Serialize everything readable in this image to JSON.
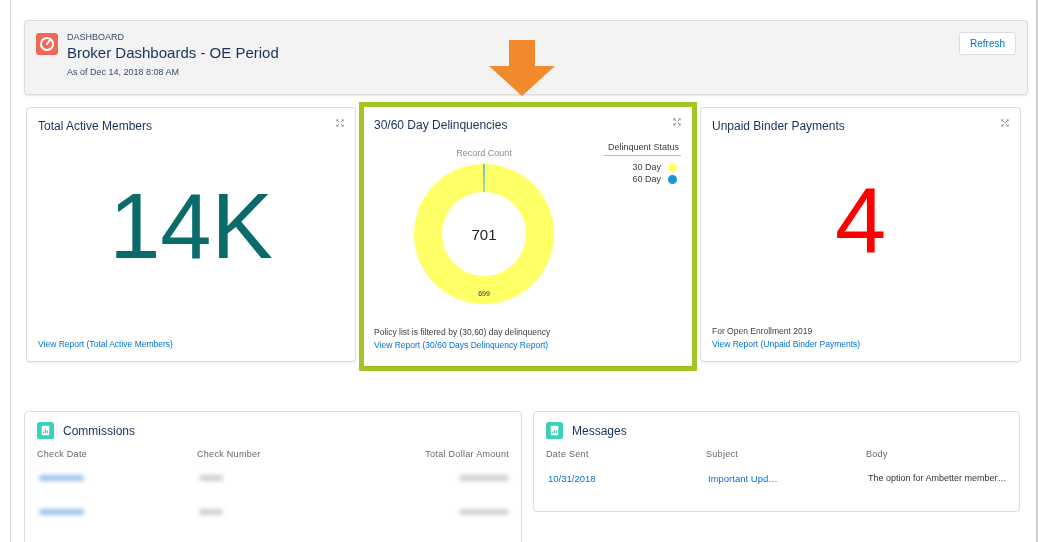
{
  "header": {
    "eyebrow": "DASHBOARD",
    "title": "Broker Dashboards - OE Period",
    "timestamp": "As of Dec 14, 2018 8:08 AM",
    "refresh_button": "Refresh"
  },
  "cards": [
    {
      "kind": "metric",
      "title": "Total Active Members",
      "highlighted": false,
      "value": "14K",
      "link": "View Report (Total Active Members)"
    },
    {
      "kind": "chart",
      "title": "30/60 Day Delinquencies",
      "highlighted": true,
      "center_label": "701",
      "note": "Policy list is filtered by (30,60) day delinquency",
      "link": "View Report (30/60 Days Delinquency Report)",
      "legend": {
        "title": "Delinquent Status",
        "items": [
          {
            "color": "#ffff66"
          },
          {
            "color": "#1b96d8"
          }
        ]
      },
      "chart_data": {
        "type": "donut",
        "title": "Record Count",
        "categories": [
          "30 Day",
          "60 Day"
        ],
        "values": [
          699,
          2
        ],
        "value_labels": [
          "699",
          null
        ]
      }
    },
    {
      "kind": "metric",
      "title": "Unpaid Binder Payments",
      "highlighted": false,
      "value": "4",
      "note": "For Open Enrollment 2019",
      "link": "View Report (Unpaid Binder Payments)"
    }
  ],
  "tables": [
    {
      "title": "Commissions",
      "columns": [
        {
          "label": "Check Date"
        },
        {
          "label": "Check Number"
        },
        {
          "label": "Total Dollar Amount"
        }
      ],
      "rows": [
        [
          {
            "kind": "redacted-link"
          },
          {
            "kind": "redacted"
          },
          {
            "kind": "redacted"
          }
        ],
        [
          {
            "kind": "redacted-link"
          },
          {
            "kind": "redacted"
          },
          {
            "kind": "redacted"
          }
        ]
      ]
    },
    {
      "title": "Messages",
      "columns": [
        {
          "label": "Date Sent"
        },
        {
          "label": "Subject"
        },
        {
          "label": "Body"
        }
      ],
      "rows": [
        [
          {
            "kind": "link",
            "text": "10/31/2018"
          },
          {
            "kind": "link",
            "text": "Important Upd…"
          },
          {
            "kind": "text",
            "text": "The option for Ambetter member…"
          }
        ]
      ]
    }
  ]
}
